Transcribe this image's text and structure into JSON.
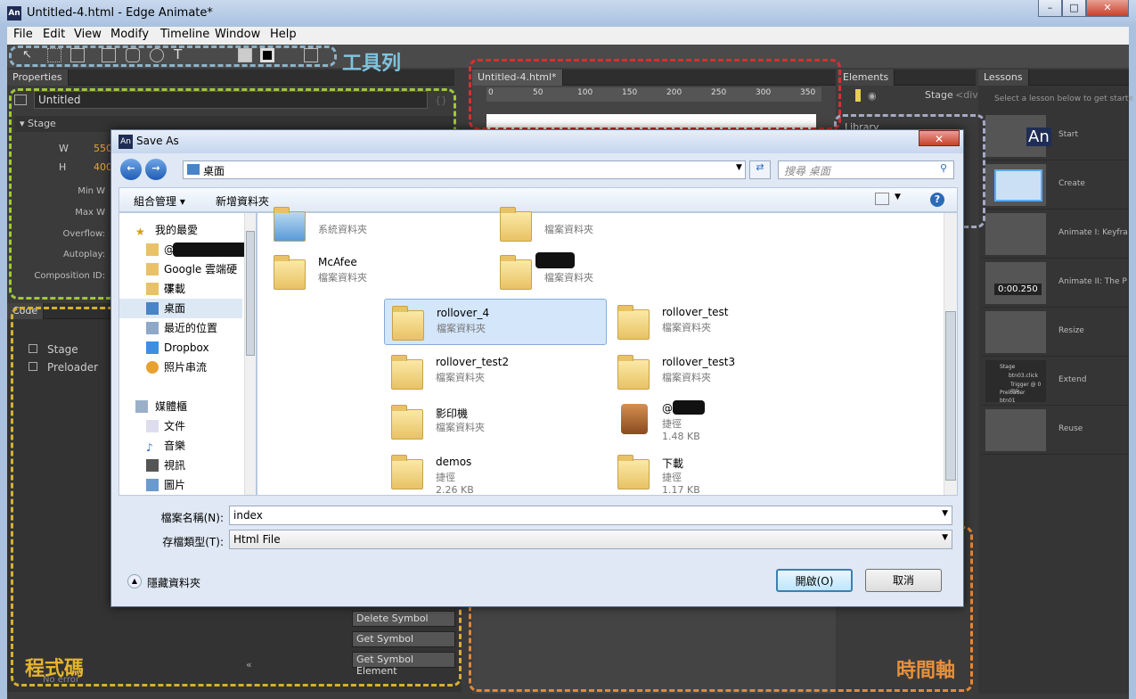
{
  "window": {
    "title": "Untitled-4.html - Edge Animate*",
    "app_icon": "An"
  },
  "menu": [
    "File",
    "Edit",
    "View",
    "Modify",
    "Timeline",
    "Window",
    "Help"
  ],
  "annotations": {
    "toolbar": "工具列",
    "code": "程式碼",
    "timeline": "時間軸"
  },
  "properties": {
    "tab": "Properties",
    "name": "Untitled",
    "section": "Stage",
    "w_label": "W",
    "w_value": "550",
    "h_label": "H",
    "h_value": "400",
    "fields": [
      "Min W",
      "Max W",
      "Overflow:",
      "Autoplay:",
      "Composition ID:"
    ],
    "braces": "{}"
  },
  "code": {
    "tab": "Code",
    "items": [
      "Stage",
      "Preloader"
    ],
    "buttons": [
      "Delete Symbol",
      "Get Symbol",
      "Get Symbol Element"
    ],
    "status": "No error"
  },
  "stage": {
    "tab": "Untitled-4.html*",
    "ruler": [
      "0",
      "50",
      "100",
      "150",
      "200",
      "250",
      "300",
      "350"
    ]
  },
  "elements": {
    "tab": "Elements",
    "stage_label": "Stage",
    "tag": "<div>"
  },
  "library": {
    "tab": "Library"
  },
  "lessons": {
    "tab": "Lessons",
    "intro": "Select a lesson below to get starte",
    "items": [
      "Start",
      "Create",
      "Animate I: Keyfra",
      "Animate II: The P",
      "Resize",
      "Extend",
      "Reuse"
    ],
    "time": "0:00.250",
    "tree": [
      "Stage",
      "btn03.click",
      "Trigger @ 0 ms",
      "Preloader",
      "btn01"
    ]
  },
  "dialog": {
    "title": "Save As",
    "address": "桌面",
    "search_placeholder": "搜尋 桌面",
    "organize": "組合管理 ▾",
    "new_folder": "新增資料夾",
    "nav": {
      "favorites": "我的最愛",
      "fav_items": [
        "@",
        "Google 雲端硬碟",
        "下載",
        "桌面",
        "最近的位置",
        "Dropbox",
        "照片串流"
      ],
      "libraries": "媒體櫃",
      "lib_items": [
        "文件",
        "音樂",
        "視訊",
        "圖片"
      ]
    },
    "files": [
      {
        "name": "",
        "type": "系統資料夾"
      },
      {
        "name": "",
        "type": "檔案資料夾"
      },
      {
        "name": "McAfee",
        "type": "檔案資料夾"
      },
      {
        "name": "",
        "type": "檔案資料夾"
      },
      {
        "name": "rollover_4",
        "type": "檔案資料夾"
      },
      {
        "name": "rollover_test",
        "type": "檔案資料夾"
      },
      {
        "name": "rollover_test2",
        "type": "檔案資料夾"
      },
      {
        "name": "rollover_test3",
        "type": "檔案資料夾"
      },
      {
        "name": "影印機",
        "type": "檔案資料夾"
      },
      {
        "name": "@",
        "type": "捷徑",
        "size": "1.48 KB"
      },
      {
        "name": "demos",
        "type": "捷徑",
        "size": "2.26 KB"
      },
      {
        "name": "下載",
        "type": "捷徑",
        "size": "1.17 KB"
      }
    ],
    "filename_label": "檔案名稱(N):",
    "filename_value": "index",
    "filetype_label": "存檔類型(T):",
    "filetype_value": "Html File",
    "hide_folders": "隱藏資料夾",
    "open_button": "開啟(O)",
    "cancel_button": "取消"
  }
}
